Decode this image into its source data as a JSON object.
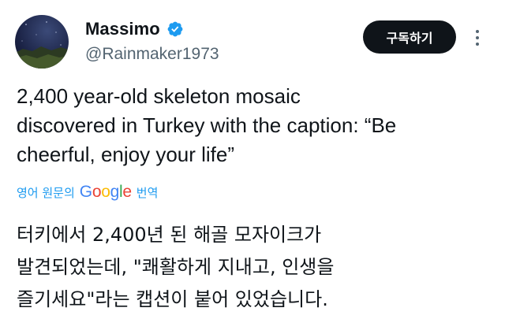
{
  "author": {
    "display_name": "Massimo",
    "handle": "@Rainmaker1973"
  },
  "colors": {
    "accent": "#1d9bf0",
    "text": "#0f1419",
    "muted": "#536471",
    "button_bg": "#0f1419"
  },
  "icons": {
    "verified": "verified-badge-icon",
    "more": "more-vertical-icon"
  },
  "subscribe_label": "구독하기",
  "tweet": {
    "lines": [
      "2,400 year-old skeleton mosaic",
      "discovered in Turkey with the caption: “Be",
      "cheerful, enjoy your life”"
    ]
  },
  "translation": {
    "prefix": "영어 원문의",
    "logo_letters": [
      "G",
      "o",
      "o",
      "g",
      "l",
      "e"
    ],
    "suffix": "번역",
    "lines": [
      "터키에서 2,400년 된 해골 모자이크가",
      "발견되었는데, \"쾌활하게 지내고, 인생을",
      "즐기세요\"라는 캡션이 붙어 있었습니다."
    ]
  }
}
